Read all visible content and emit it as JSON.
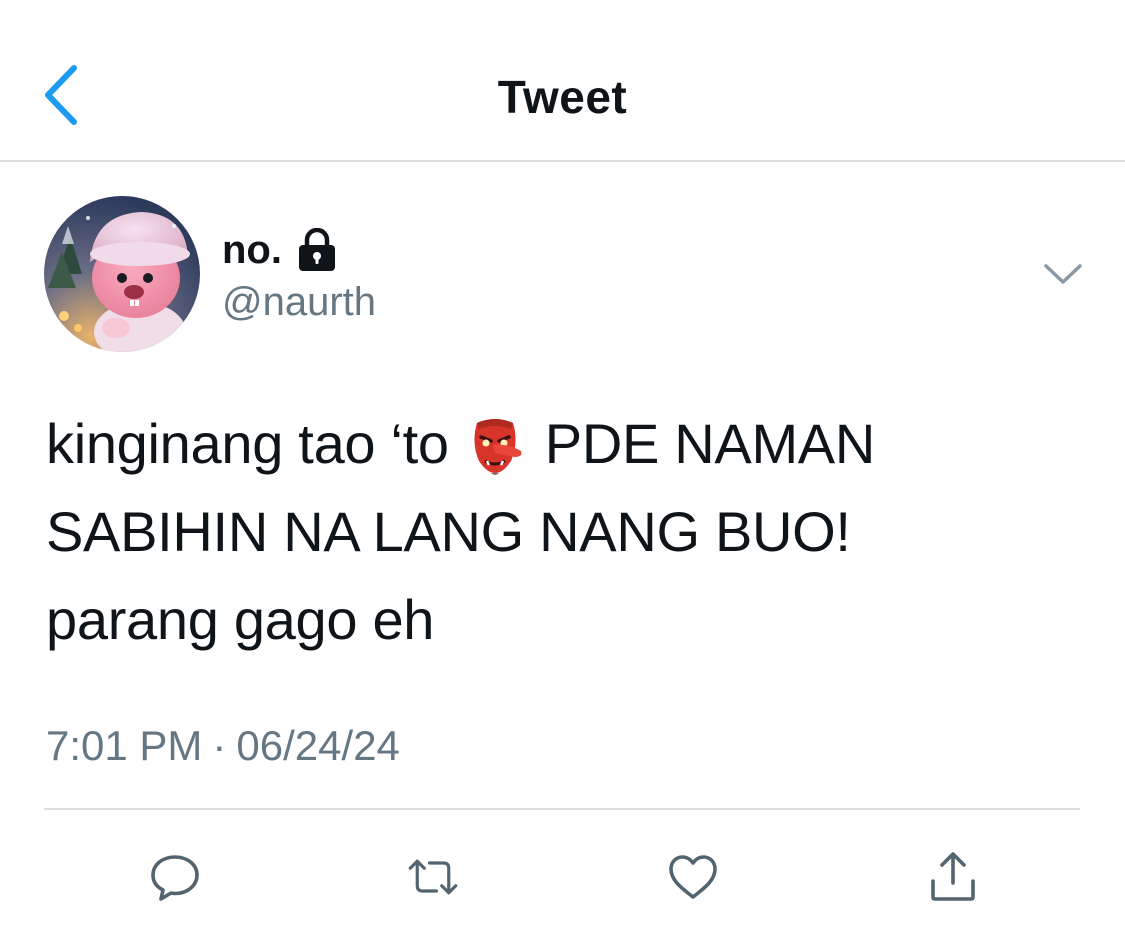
{
  "header": {
    "title": "Tweet",
    "back_icon": "chevron-left-icon"
  },
  "author": {
    "display_name": "no.",
    "handle": "@naurth",
    "protected_icon": "lock-icon",
    "avatar_icon": "avatar-image"
  },
  "tweet": {
    "line1_before": "kinginang tao ‘to",
    "line1_emoji": "goblin-emoji",
    "line1_after": "PDE NAMAN",
    "line2": "SABIHIN NA LANG NANG BUO!",
    "line3": "parang gago eh"
  },
  "meta": {
    "time": "7:01 PM",
    "separator": "·",
    "date": "06/24/24"
  },
  "actions": {
    "reply_icon": "reply-icon",
    "retweet_icon": "retweet-icon",
    "like_icon": "heart-icon",
    "share_icon": "share-icon"
  },
  "colors": {
    "accent": "#1d9bf0",
    "text": "#0f1419",
    "secondary": "#667784",
    "divider": "#dcdfe2"
  }
}
